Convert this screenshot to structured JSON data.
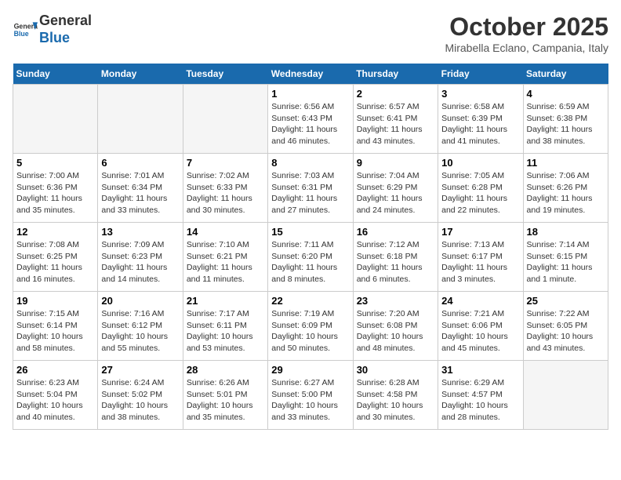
{
  "header": {
    "logo_general": "General",
    "logo_blue": "Blue",
    "month_title": "October 2025",
    "location": "Mirabella Eclano, Campania, Italy"
  },
  "days_of_week": [
    "Sunday",
    "Monday",
    "Tuesday",
    "Wednesday",
    "Thursday",
    "Friday",
    "Saturday"
  ],
  "weeks": [
    [
      {
        "day": "",
        "info": ""
      },
      {
        "day": "",
        "info": ""
      },
      {
        "day": "",
        "info": ""
      },
      {
        "day": "1",
        "info": "Sunrise: 6:56 AM\nSunset: 6:43 PM\nDaylight: 11 hours and 46 minutes."
      },
      {
        "day": "2",
        "info": "Sunrise: 6:57 AM\nSunset: 6:41 PM\nDaylight: 11 hours and 43 minutes."
      },
      {
        "day": "3",
        "info": "Sunrise: 6:58 AM\nSunset: 6:39 PM\nDaylight: 11 hours and 41 minutes."
      },
      {
        "day": "4",
        "info": "Sunrise: 6:59 AM\nSunset: 6:38 PM\nDaylight: 11 hours and 38 minutes."
      }
    ],
    [
      {
        "day": "5",
        "info": "Sunrise: 7:00 AM\nSunset: 6:36 PM\nDaylight: 11 hours and 35 minutes."
      },
      {
        "day": "6",
        "info": "Sunrise: 7:01 AM\nSunset: 6:34 PM\nDaylight: 11 hours and 33 minutes."
      },
      {
        "day": "7",
        "info": "Sunrise: 7:02 AM\nSunset: 6:33 PM\nDaylight: 11 hours and 30 minutes."
      },
      {
        "day": "8",
        "info": "Sunrise: 7:03 AM\nSunset: 6:31 PM\nDaylight: 11 hours and 27 minutes."
      },
      {
        "day": "9",
        "info": "Sunrise: 7:04 AM\nSunset: 6:29 PM\nDaylight: 11 hours and 24 minutes."
      },
      {
        "day": "10",
        "info": "Sunrise: 7:05 AM\nSunset: 6:28 PM\nDaylight: 11 hours and 22 minutes."
      },
      {
        "day": "11",
        "info": "Sunrise: 7:06 AM\nSunset: 6:26 PM\nDaylight: 11 hours and 19 minutes."
      }
    ],
    [
      {
        "day": "12",
        "info": "Sunrise: 7:08 AM\nSunset: 6:25 PM\nDaylight: 11 hours and 16 minutes."
      },
      {
        "day": "13",
        "info": "Sunrise: 7:09 AM\nSunset: 6:23 PM\nDaylight: 11 hours and 14 minutes."
      },
      {
        "day": "14",
        "info": "Sunrise: 7:10 AM\nSunset: 6:21 PM\nDaylight: 11 hours and 11 minutes."
      },
      {
        "day": "15",
        "info": "Sunrise: 7:11 AM\nSunset: 6:20 PM\nDaylight: 11 hours and 8 minutes."
      },
      {
        "day": "16",
        "info": "Sunrise: 7:12 AM\nSunset: 6:18 PM\nDaylight: 11 hours and 6 minutes."
      },
      {
        "day": "17",
        "info": "Sunrise: 7:13 AM\nSunset: 6:17 PM\nDaylight: 11 hours and 3 minutes."
      },
      {
        "day": "18",
        "info": "Sunrise: 7:14 AM\nSunset: 6:15 PM\nDaylight: 11 hours and 1 minute."
      }
    ],
    [
      {
        "day": "19",
        "info": "Sunrise: 7:15 AM\nSunset: 6:14 PM\nDaylight: 10 hours and 58 minutes."
      },
      {
        "day": "20",
        "info": "Sunrise: 7:16 AM\nSunset: 6:12 PM\nDaylight: 10 hours and 55 minutes."
      },
      {
        "day": "21",
        "info": "Sunrise: 7:17 AM\nSunset: 6:11 PM\nDaylight: 10 hours and 53 minutes."
      },
      {
        "day": "22",
        "info": "Sunrise: 7:19 AM\nSunset: 6:09 PM\nDaylight: 10 hours and 50 minutes."
      },
      {
        "day": "23",
        "info": "Sunrise: 7:20 AM\nSunset: 6:08 PM\nDaylight: 10 hours and 48 minutes."
      },
      {
        "day": "24",
        "info": "Sunrise: 7:21 AM\nSunset: 6:06 PM\nDaylight: 10 hours and 45 minutes."
      },
      {
        "day": "25",
        "info": "Sunrise: 7:22 AM\nSunset: 6:05 PM\nDaylight: 10 hours and 43 minutes."
      }
    ],
    [
      {
        "day": "26",
        "info": "Sunrise: 6:23 AM\nSunset: 5:04 PM\nDaylight: 10 hours and 40 minutes."
      },
      {
        "day": "27",
        "info": "Sunrise: 6:24 AM\nSunset: 5:02 PM\nDaylight: 10 hours and 38 minutes."
      },
      {
        "day": "28",
        "info": "Sunrise: 6:26 AM\nSunset: 5:01 PM\nDaylight: 10 hours and 35 minutes."
      },
      {
        "day": "29",
        "info": "Sunrise: 6:27 AM\nSunset: 5:00 PM\nDaylight: 10 hours and 33 minutes."
      },
      {
        "day": "30",
        "info": "Sunrise: 6:28 AM\nSunset: 4:58 PM\nDaylight: 10 hours and 30 minutes."
      },
      {
        "day": "31",
        "info": "Sunrise: 6:29 AM\nSunset: 4:57 PM\nDaylight: 10 hours and 28 minutes."
      },
      {
        "day": "",
        "info": ""
      }
    ]
  ]
}
